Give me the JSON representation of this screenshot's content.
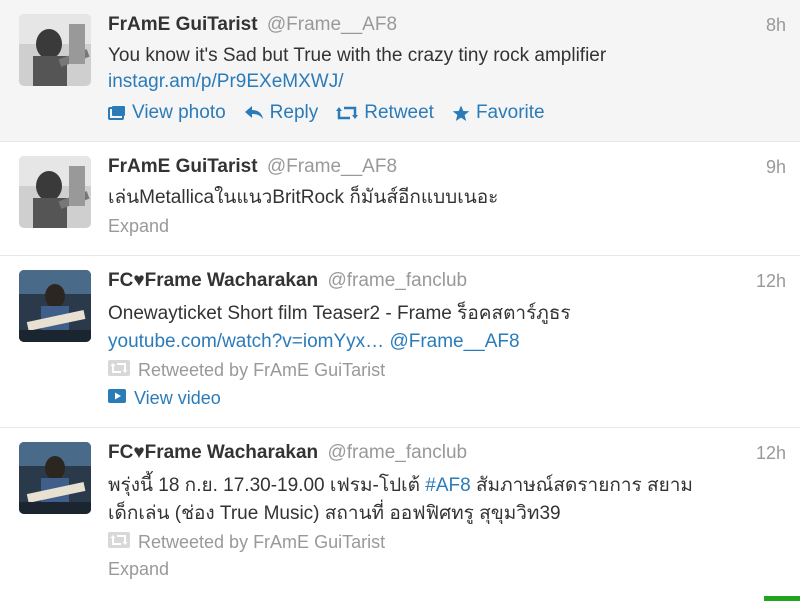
{
  "tweets": [
    {
      "name": "FrAmE GuiTarist",
      "handle": "@Frame__AF8",
      "time": "8h",
      "text": "You know it's Sad but True with the crazy tiny rock amplifier",
      "link": "instagr.am/p/Pr9EXeMXWJ/",
      "actions": {
        "view_photo": "View photo",
        "reply": "Reply",
        "retweet": "Retweet",
        "favorite": "Favorite"
      }
    },
    {
      "name": "FrAmE GuiTarist",
      "handle": "@Frame__AF8",
      "time": "9h",
      "text": "เล่นMetallicaในแนวBritRock ก็มันส์อีกแบบเนอะ",
      "expand": "Expand"
    },
    {
      "name": "FC♥Frame Wacharakan",
      "handle": "@frame_fanclub",
      "time": "12h",
      "text": "Onewayticket Short film Teaser2 - Frame ร็อคสตาร์ภูธร",
      "link": "youtube.com/watch?v=iomYyx…",
      "mention": "@Frame__AF8",
      "retweeted_by": "Retweeted by FrAmE GuiTarist",
      "view_video": "View video"
    },
    {
      "name": "FC♥Frame Wacharakan",
      "handle": "@frame_fanclub",
      "time": "12h",
      "text_part1": "พรุ่งนี้ 18 ก.ย. 17.30-19.00 เฟรม-โปเต้",
      "hashtag": "#AF8",
      "text_part2": "สัมภาษณ์สดรายการ สยาม",
      "text_line2": "เด็กเล่น (ช่อง True Music) สถานที่ ออฟฟิศทรู สุขุมวิท39",
      "retweeted_by": "Retweeted by FrAmE GuiTarist",
      "expand": "Expand"
    }
  ],
  "colors": {
    "link": "#2b7bb9",
    "muted": "#999999",
    "highlight_bg": "#f5f5f5",
    "corner": "#21a51f"
  },
  "icons": [
    "photo-icon",
    "reply-icon",
    "retweet-icon",
    "star-icon",
    "video-icon"
  ]
}
